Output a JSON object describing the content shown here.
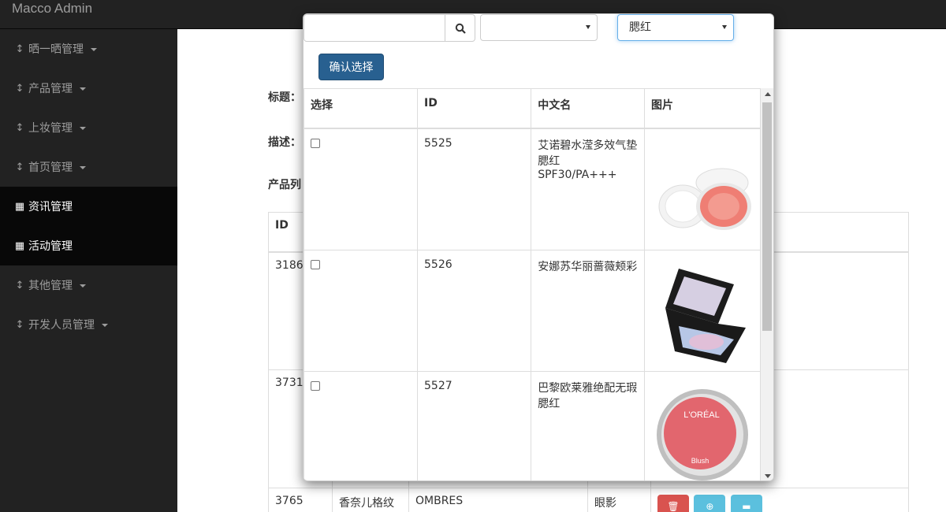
{
  "app": {
    "brand": "Macco Admin"
  },
  "sidebar": {
    "items": [
      {
        "label": "晒一晒管理",
        "icon": "sort-vertical-icon",
        "active": false,
        "dropdown": true
      },
      {
        "label": "产品管理",
        "icon": "sort-vertical-icon",
        "active": false,
        "dropdown": true
      },
      {
        "label": "上妆管理",
        "icon": "sort-vertical-icon",
        "active": false,
        "dropdown": true
      },
      {
        "label": "首页管理",
        "icon": "sort-vertical-icon",
        "active": false,
        "dropdown": true
      },
      {
        "label": "资讯管理",
        "icon": "table-icon",
        "active": true,
        "dropdown": false
      },
      {
        "label": "活动管理",
        "icon": "table-icon",
        "active": true,
        "dropdown": false
      },
      {
        "label": "其他管理",
        "icon": "sort-vertical-icon",
        "active": false,
        "dropdown": true
      },
      {
        "label": "开发人员管理",
        "icon": "sort-vertical-icon",
        "active": false,
        "dropdown": true
      }
    ]
  },
  "page": {
    "title_label": "标题：",
    "desc_label": "描述：",
    "product_list_label": "产品列",
    "table": {
      "header_id": "ID",
      "rows": [
        {
          "id": "3186"
        },
        {
          "id": "3731"
        },
        {
          "id": "3765",
          "name": "香奈儿格纹",
          "code": "OMBRES",
          "category": "眼影"
        }
      ]
    }
  },
  "modal": {
    "search": {
      "value": "",
      "placeholder": ""
    },
    "select_brand": {
      "value": ""
    },
    "select_category": {
      "value": "腮红"
    },
    "confirm_label": "确认选择",
    "table": {
      "headers": {
        "select": "选择",
        "id": "ID",
        "name": "中文名",
        "image": "图片"
      },
      "rows": [
        {
          "id": "5525",
          "name": "艾诺碧水滢多效气垫腮红SPF30/PA+++",
          "image": "cushion-blush-image"
        },
        {
          "id": "5526",
          "name": "安娜苏华丽蔷薇颊彩",
          "image": "eyeshadow-palette-image"
        },
        {
          "id": "5527",
          "name": "巴黎欧莱雅绝配无瑕腮红",
          "image": "loreal-blush-image",
          "image_text": "L'ORÉAL",
          "image_subtext": "Blush"
        }
      ]
    }
  },
  "colors": {
    "sidebar_bg": "#222222",
    "active_bg": "#080808",
    "primary": "#286090",
    "danger": "#d9534f",
    "info": "#5bc0de"
  }
}
